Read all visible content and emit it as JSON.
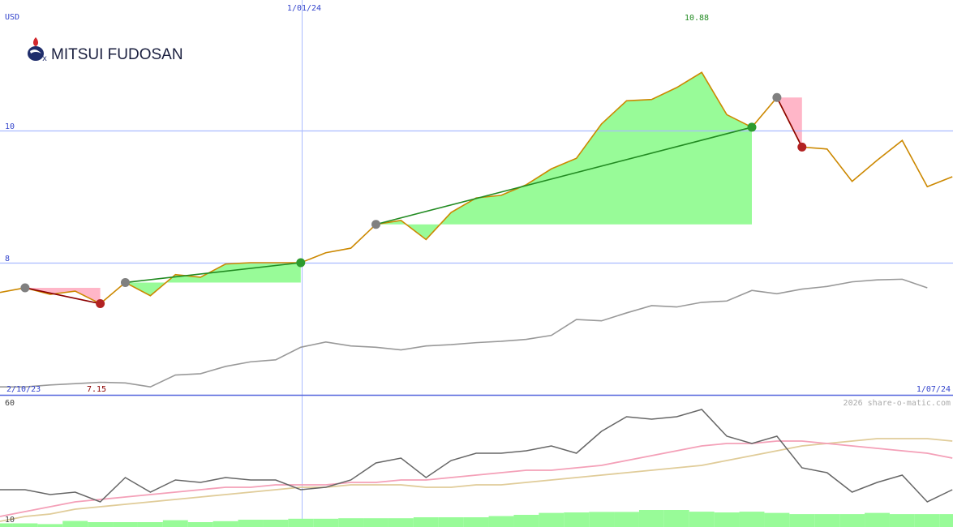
{
  "chart_data": [
    {
      "type": "line",
      "panel": "price",
      "currency_label": "USD",
      "brand": "MITSUI FUDOSAN",
      "x_start_label": "2/10/23",
      "x_end_label": "1/07/24",
      "x_marker_label": "1/01/24",
      "high_label": "10.88",
      "low_label": "7.15",
      "y_gridlines": [
        10,
        8
      ],
      "y_tick_labels": [
        "10",
        "8"
      ],
      "ylim": [
        6.0,
        11.9
      ],
      "grid": true,
      "colors": {
        "price": "#cc8800",
        "relative": "#999999",
        "gain_fill": "#98fb98",
        "loss_fill": "#ffb6c8",
        "up_trend": "#228b22",
        "down_trend": "#8b0000",
        "grid": "#aabbff",
        "axis_text": "#3344cc",
        "high_text": "#228b22",
        "low_text": "#8b0000"
      },
      "series": [
        {
          "values": [
            7.55,
            7.62,
            7.52,
            7.57,
            7.38,
            7.7,
            7.5,
            7.82,
            7.78,
            7.98,
            8.0,
            8.0,
            8.0,
            8.15,
            8.22,
            8.58,
            8.64,
            8.35,
            8.76,
            8.98,
            9.02,
            9.18,
            9.42,
            9.58,
            10.1,
            10.45,
            10.47,
            10.65,
            10.88,
            10.24,
            10.05,
            10.5,
            9.75,
            9.72,
            9.23,
            9.55,
            9.85,
            9.15,
            9.3
          ]
        },
        {
          "values": [
            6.12,
            6.12,
            6.15,
            6.17,
            6.19,
            6.18,
            6.12,
            6.3,
            6.32,
            6.43,
            6.5,
            6.53,
            6.72,
            6.8,
            6.74,
            6.72,
            6.68,
            6.74,
            6.76,
            6.79,
            6.81,
            6.84,
            6.9,
            7.14,
            7.12,
            7.24,
            7.35,
            7.33,
            7.4,
            7.42,
            7.58,
            7.53,
            7.6,
            7.64,
            7.71,
            7.74,
            7.75,
            7.62
          ]
        }
      ],
      "trades": [
        {
          "start_index": 1,
          "end_index": 4,
          "start_value": 7.62,
          "end_value": 7.38,
          "result": "loss"
        },
        {
          "start_index": 5,
          "end_index": 12,
          "start_value": 7.7,
          "end_value": 8.0,
          "result": "gain"
        },
        {
          "start_index": 15,
          "end_index": 30,
          "start_value": 8.58,
          "end_value": 10.05,
          "result": "gain"
        },
        {
          "start_index": 31,
          "end_index": 32,
          "start_value": 10.5,
          "end_value": 9.75,
          "result": "loss"
        }
      ]
    },
    {
      "type": "line",
      "panel": "indicator",
      "y_tick_labels": [
        "60",
        "10"
      ],
      "ylim": [
        10,
        60
      ],
      "watermark": "2026 share-o-matic.com",
      "colors": {
        "oscillator": "#666666",
        "fast_avg": "#f4a0b8",
        "slow_avg": "#e0cc99",
        "volume": "#98fb98"
      },
      "series": [
        {
          "values": [
            23,
            23,
            21,
            22,
            18,
            28,
            22,
            27,
            26,
            28,
            27,
            27,
            23,
            24,
            27,
            34,
            36,
            28,
            35,
            38,
            38,
            39,
            41,
            38,
            47,
            53,
            52,
            53,
            56,
            45,
            42,
            45,
            32,
            30,
            22,
            26,
            29,
            18,
            23
          ]
        },
        {
          "values": [
            12,
            14,
            16,
            18,
            19,
            20,
            21,
            22,
            23,
            24,
            24,
            25,
            25,
            25,
            26,
            26,
            27,
            27,
            28,
            29,
            30,
            31,
            31,
            32,
            33,
            35,
            37,
            39,
            41,
            42,
            42,
            43,
            43,
            42,
            41,
            40,
            39,
            38,
            36
          ]
        },
        {
          "values": [
            10,
            12,
            13,
            15,
            16,
            17,
            18,
            19,
            20,
            21,
            22,
            23,
            24,
            24,
            25,
            25,
            25,
            24,
            24,
            25,
            25,
            26,
            27,
            28,
            29,
            30,
            31,
            32,
            33,
            35,
            37,
            39,
            41,
            42,
            43,
            44,
            44,
            44,
            43
          ]
        },
        {
          "values": [
            1.5,
            1.5,
            1.2,
            2.5,
            2.0,
            2.0,
            2.0,
            2.8,
            2.0,
            2.4,
            3.0,
            3.0,
            3.4,
            3.4,
            3.6,
            3.6,
            3.6,
            4.0,
            4.0,
            4.0,
            4.5,
            5.0,
            5.8,
            6.0,
            6.2,
            6.2,
            7.0,
            7.0,
            6.3,
            6.0,
            6.3,
            5.8,
            5.3,
            5.3,
            5.3,
            5.8,
            5.3,
            5.3,
            5.3
          ]
        }
      ]
    }
  ]
}
